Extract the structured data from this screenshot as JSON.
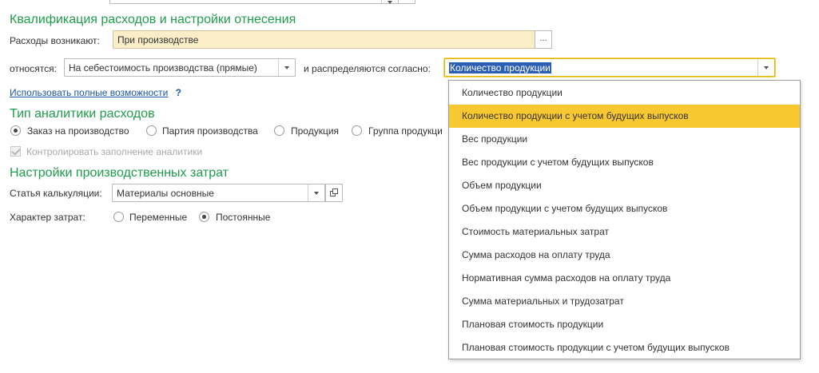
{
  "top_partial": {
    "field_text": ""
  },
  "section1": {
    "title": "Квалификация расходов и настройки отнесения",
    "expenses_label": "Расходы возникают:",
    "expenses_value": "При производстве",
    "ellipsis": "...",
    "relate_label": "относятся:",
    "relate_value": "На себестоимость производства (прямые)",
    "distribute_label": "и распределяются согласно:",
    "distribute_value": "Количество продукции",
    "link": "Использовать полные возможности",
    "help": "?"
  },
  "section2": {
    "title": "Тип аналитики расходов",
    "radios": [
      {
        "label": "Заказ на производство",
        "checked": true
      },
      {
        "label": "Партия производства",
        "checked": false
      },
      {
        "label": "Продукция",
        "checked": false
      },
      {
        "label": "Группа продукци",
        "checked": false
      }
    ],
    "check_label": "Контролировать заполнение аналитики"
  },
  "section3": {
    "title": "Настройки производственных затрат",
    "article_label": "Статья калькуляции:",
    "article_value": "Материалы основные",
    "nature_label": "Характер затрат:",
    "nature_options": [
      {
        "label": "Переменные",
        "checked": false
      },
      {
        "label": "Постоянные",
        "checked": true
      }
    ]
  },
  "dropdown": {
    "selected_index": 1,
    "options": [
      "Количество продукции",
      "Количество продукции с учетом будущих выпусков",
      "Вес продукции",
      "Вес продукции с учетом будущих выпусков",
      "Объем продукции",
      "Объем продукции с учетом будущих выпусков",
      "Стоимость материальных затрат",
      "Сумма расходов на оплату труда",
      "Нормативная сумма расходов на оплату труда",
      "Сумма материальных и трудозатрат",
      "Плановая стоимость продукции",
      "Плановая стоимость продукции с учетом будущих выпусков"
    ]
  }
}
